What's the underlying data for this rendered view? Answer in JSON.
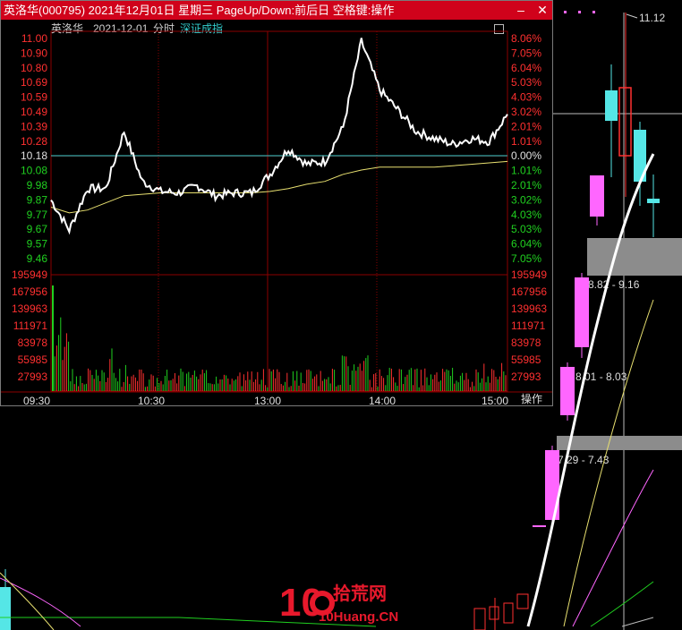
{
  "window": {
    "title": "英洛华(000795) 2021年12月01日 星期三 PageUp/Down:前后日 空格键:操作",
    "minimize_label": "–",
    "close_label": "✕"
  },
  "subheader": {
    "stock_name": "英洛华",
    "date": "2021-12-01",
    "mode": "分时",
    "index_name": "深证成指"
  },
  "price_axis": {
    "left_labels": [
      "11.00",
      "10.90",
      "10.80",
      "10.69",
      "10.59",
      "10.49",
      "10.39",
      "10.28",
      "10.18",
      "10.08",
      "9.98",
      "9.87",
      "9.77",
      "9.67",
      "9.57",
      "9.46"
    ],
    "right_labels": [
      "8.06%",
      "7.05%",
      "6.04%",
      "5.03%",
      "4.03%",
      "3.02%",
      "2.01%",
      "1.01%",
      "0.00%",
      "1.01%",
      "2.01%",
      "3.02%",
      "4.03%",
      "5.03%",
      "6.04%",
      "7.05%"
    ],
    "prev_close": "10.18"
  },
  "volume_axis": {
    "labels": [
      "195949",
      "167956",
      "139963",
      "111971",
      "83978",
      "55985",
      "27993"
    ]
  },
  "time_axis": {
    "labels": [
      "09:30",
      "10:30",
      "13:00",
      "14:00",
      "15:00"
    ]
  },
  "buttons": {
    "operate_label": "操作"
  },
  "kline": {
    "high_label": "11.12",
    "box_labels": [
      "8.82 - 9.16",
      "8.01 - 8.03",
      "7.29 - 7.43"
    ]
  },
  "watermark": {
    "number": "10",
    "cn_text": "拾荒网",
    "url_text": "10Huang.CN"
  },
  "colors": {
    "title_bg": "#d0021b",
    "price_line": "#ffffff",
    "avg_line": "#e8e070",
    "up_color": "#ff3030",
    "down_color": "#20d020",
    "cyan": "#33d0d0",
    "magenta_candle": "#ff66ff",
    "cyan_candle": "#55e6e6"
  },
  "chart_data": {
    "type": "line",
    "series": [
      {
        "values_time": [
          "09:30",
          "09:40",
          "09:50",
          "10:00",
          "10:10",
          "10:20",
          "10:30",
          "10:40",
          "10:50",
          "11:00",
          "11:10",
          "11:20",
          "11:30",
          "13:00",
          "13:10",
          "13:20",
          "13:30",
          "13:40",
          "13:50",
          "14:00",
          "14:10",
          "14:20",
          "14:30",
          "14:40",
          "14:50",
          "15:00"
        ],
        "price": [
          9.87,
          9.66,
          9.95,
          9.95,
          10.35,
          10.0,
          9.93,
          9.92,
          9.97,
          9.9,
          9.92,
          9.92,
          10.05,
          10.23,
          10.12,
          10.14,
          10.38,
          10.98,
          10.64,
          10.5,
          10.35,
          10.3,
          10.26,
          10.3,
          10.28,
          10.47
        ],
        "avg": [
          9.82,
          9.78,
          9.8,
          9.85,
          9.9,
          9.91,
          9.92,
          9.92,
          9.92,
          9.92,
          9.92,
          9.92,
          9.93,
          9.95,
          9.98,
          10.0,
          10.05,
          10.08,
          10.1,
          10.1,
          10.1,
          10.1,
          10.11,
          10.12,
          10.13,
          10.14
        ]
      }
    ],
    "ylim": [
      9.46,
      11.0
    ],
    "prev_close": 10.18
  }
}
